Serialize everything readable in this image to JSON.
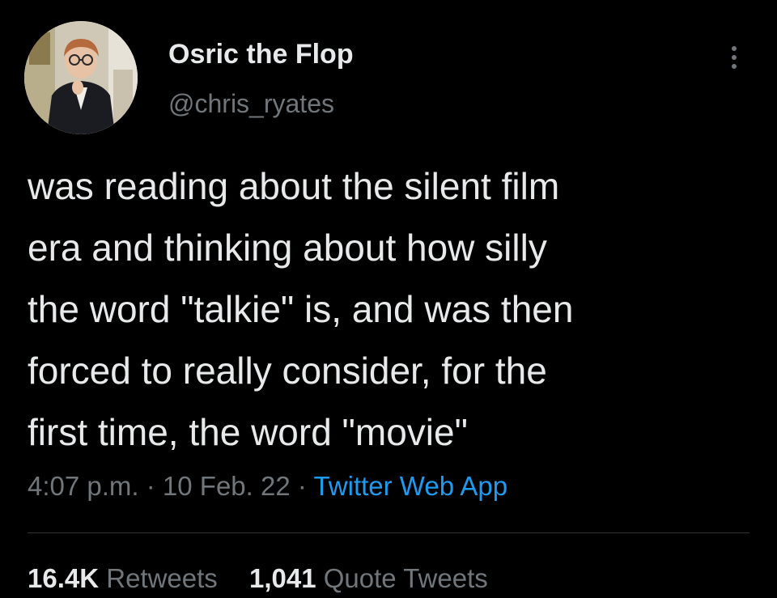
{
  "author": {
    "display_name": "Osric the Flop",
    "handle": "@chris_ryates"
  },
  "tweet": {
    "lines": [
      "was reading about the silent film",
      "era and thinking about how silly",
      "the word \"talkie\" is, and was then",
      "forced to really consider, for the",
      "first time, the word \"movie\""
    ],
    "time": "4:07 p.m.",
    "date": "10 Feb. 22",
    "source": "Twitter Web App",
    "separator": "·"
  },
  "stats": {
    "retweets_count": "16.4K",
    "retweets_label": "Retweets",
    "quotes_count": "1,041",
    "quotes_label": "Quote Tweets"
  },
  "icons": {
    "more": "more-vertical-icon"
  },
  "colors": {
    "background": "#000000",
    "text": "#e7e9ea",
    "secondary": "#71767b",
    "link": "#1d9bf0",
    "divider": "#2f3336"
  }
}
